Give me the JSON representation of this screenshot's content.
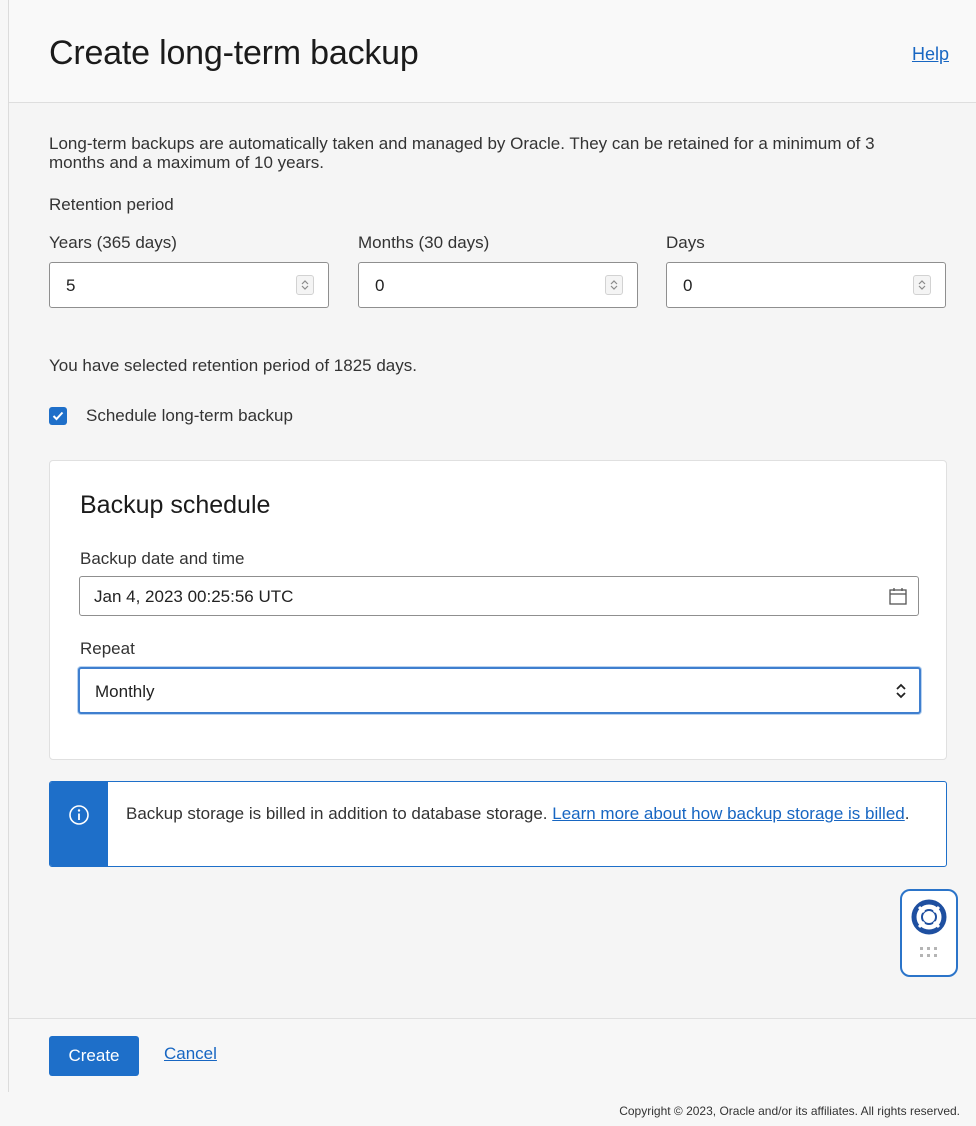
{
  "header": {
    "title": "Create long-term backup",
    "help_label": "Help"
  },
  "description": "Long-term backups are automatically taken and managed by Oracle. They can be retained for a minimum of 3 months and a maximum of 10 years.",
  "retention": {
    "section_label": "Retention period",
    "years": {
      "label": "Years (365 days)",
      "value": "5"
    },
    "months": {
      "label": "Months (30 days)",
      "value": "0"
    },
    "days": {
      "label": "Days",
      "value": "0"
    },
    "summary": "You have selected retention period of 1825 days."
  },
  "schedule_checkbox": {
    "label": "Schedule long-term backup",
    "checked": true
  },
  "backup_schedule": {
    "title": "Backup schedule",
    "datetime_label": "Backup date and time",
    "datetime_value": "Jan 4, 2023 00:25:56 UTC",
    "repeat_label": "Repeat",
    "repeat_value": "Monthly"
  },
  "info_banner": {
    "text": "Backup storage is billed in addition to database storage.",
    "link_text": "Learn more about how backup storage is billed",
    "trailing": "."
  },
  "footer": {
    "create_label": "Create",
    "cancel_label": "Cancel"
  },
  "copyright": "Copyright © 2023, Oracle and/or its affiliates. All rights reserved.",
  "colors": {
    "accent": "#1e6fc9",
    "link": "#1766c2",
    "background": "#f5f5f5"
  }
}
